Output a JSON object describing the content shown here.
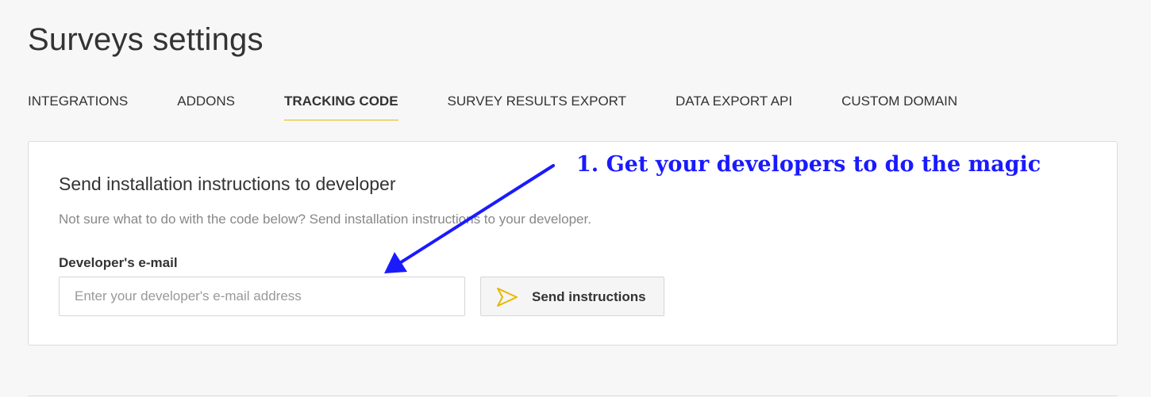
{
  "page": {
    "title": "Surveys settings"
  },
  "tabs": [
    {
      "label": "INTEGRATIONS",
      "active": false
    },
    {
      "label": "ADDONS",
      "active": false
    },
    {
      "label": "TRACKING CODE",
      "active": true
    },
    {
      "label": "SURVEY RESULTS EXPORT",
      "active": false
    },
    {
      "label": "DATA EXPORT API",
      "active": false
    },
    {
      "label": "CUSTOM DOMAIN",
      "active": false
    }
  ],
  "card": {
    "title": "Send installation instructions to developer",
    "description": "Not sure what to do with the code below? Send installation instructions to your developer.",
    "field_label": "Developer's e-mail",
    "email_placeholder": "Enter your developer's e-mail address",
    "email_value": "",
    "send_button_label": "Send instructions",
    "send_icon": "paper-plane-icon"
  },
  "annotation": {
    "text": "1. Get your developers to do the magic",
    "color": "#1a1aff"
  },
  "colors": {
    "active_tab_underline": "#e5b800",
    "send_icon": "#e8b800"
  }
}
